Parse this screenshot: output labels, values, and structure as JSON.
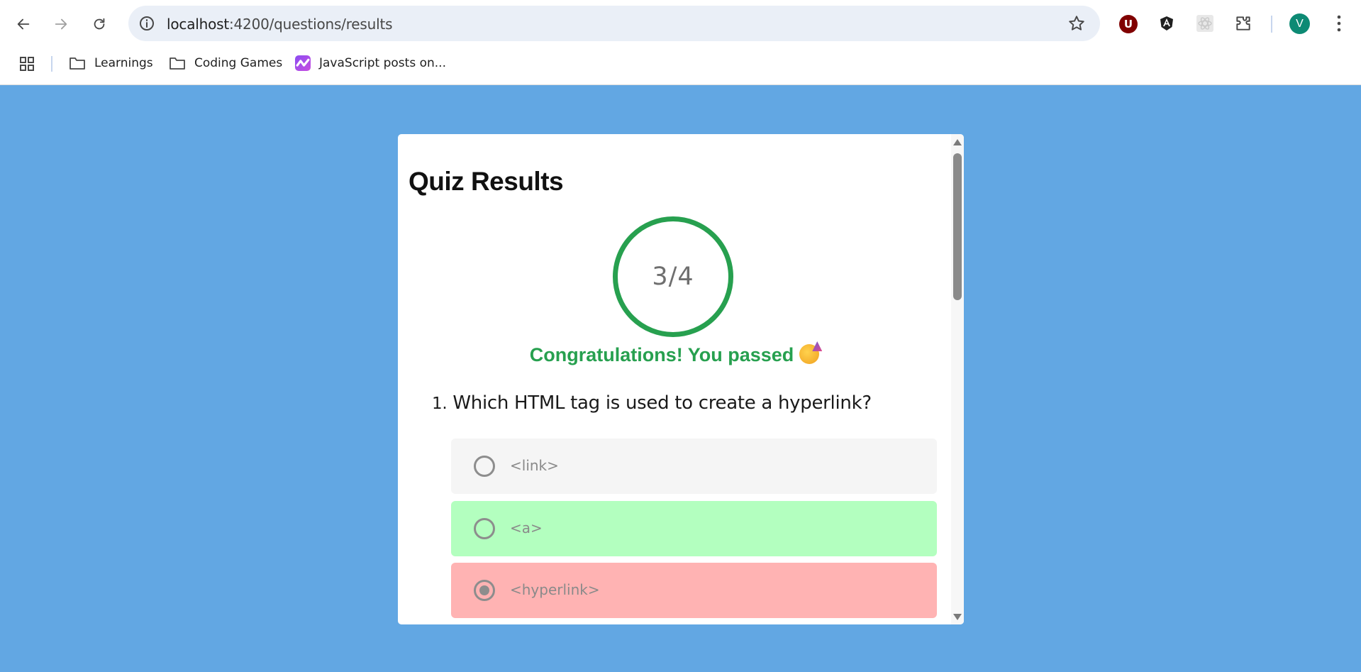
{
  "browser": {
    "url_host": "localhost",
    "url_path": ":4200/questions/results",
    "avatar_letter": "V",
    "ublock_letter": "U",
    "bookmarks": [
      {
        "label": "Learnings",
        "icon": "folder-icon"
      },
      {
        "label": "Coding Games",
        "icon": "folder-icon"
      },
      {
        "label": "JavaScript posts on...",
        "icon": "dev-community-icon"
      }
    ]
  },
  "quiz": {
    "title": "Quiz Results",
    "score": "3/4",
    "pass_message": "Congratulations! You passed",
    "pass_emoji": "party-face-icon",
    "questions": [
      {
        "number": "1.",
        "text": "Which HTML tag is used to create a hyperlink?",
        "options": [
          {
            "label": "<link>",
            "state": "neutral",
            "selected": false
          },
          {
            "label": "<a>",
            "state": "correct",
            "selected": false
          },
          {
            "label": "<hyperlink>",
            "state": "wrong",
            "selected": true
          }
        ]
      }
    ]
  },
  "colors": {
    "page_background": "#62a7e3",
    "success_green": "#27a04f",
    "correct_option": "#b3ffbf",
    "wrong_option": "#ffb3b3",
    "neutral_option": "#f5f5f5"
  }
}
